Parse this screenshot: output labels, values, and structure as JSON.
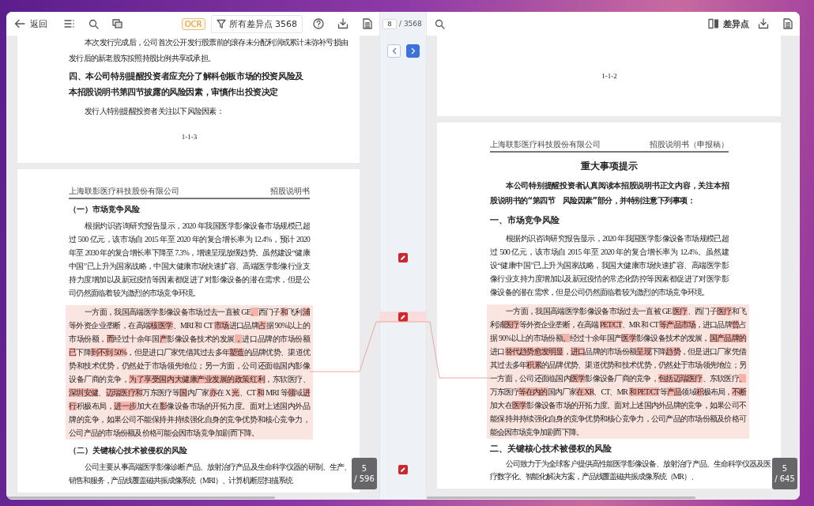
{
  "toolbar": {
    "back": "返回",
    "ocr": "OCR",
    "filter": "所有差异点 3568"
  },
  "navigator": {
    "current": "8",
    "total": "/ 3568"
  },
  "right_toolbar": {
    "diff_toggle": "差异点"
  },
  "documents": [
    {
      "pages": [
        {
          "blocks": [
            {
              "kind": "para",
              "text": "本次发行完成后，公司首次公开发行股票前的滚存未分配利润或累计未弥补亏损由"
            },
            {
              "kind": "plain",
              "text": "发行后的新老股东按照持股比例共享或承担。"
            },
            {
              "kind": "big_heading",
              "text": "四、本公司特别提醒投资者应充分了解科创板市场的投资风险及本招股说明书第四节披露的风险因素，审慎作出投资决定"
            },
            {
              "kind": "para",
              "text": "发行人特别提醒投资者关注以下风险因素："
            },
            {
              "kind": "footer",
              "text": "1-1-3"
            }
          ]
        },
        {
          "blocks": [
            {
              "kind": "header",
              "left": "上海联影医疗科技股份有限公司",
              "right": "招股说明书"
            },
            {
              "kind": "heading",
              "text": "（一）市场竞争风险"
            },
            {
              "kind": "para",
              "text": "根据灼识咨询研究报告显示，2020 年我国医学影像设备市场规模已超过 500 亿元，该市场自 2015 年至 2020 年的复合增长率为 12.4%，预计 2020 年至 2030 年的复合增长率下降至 7.3%，增速呈现放缓趋势。虽然建设“健康中国”已上升为国家战略，中国大健康市场快速扩容、高端医学影像行业支持力度增加以及新冠疫情等因素都促进了对影像设备的潜在需求，但是公司仍然面临着较为激烈的市场竞争环境。"
            },
            {
              "kind": "diff",
              "segments": [
                {
                  "text": "一方面，我国高端医学影像设备市场过去一直被 GE",
                  "changed": false
                },
                {
                  "text": "、",
                  "changed": true
                },
                {
                  "text": "西门子",
                  "changed": false
                },
                {
                  "text": "和",
                  "changed": true
                },
                {
                  "text": "飞利",
                  "changed": false
                },
                {
                  "text": "浦",
                  "changed": true
                },
                {
                  "text": "等外资企业垄断，在高端",
                  "changed": false
                },
                {
                  "text": "核医学",
                  "changed": true
                },
                {
                  "text": "、MRI 和 CT ",
                  "changed": false
                },
                {
                  "text": "市场",
                  "changed": true
                },
                {
                  "text": "进口品牌",
                  "changed": false
                },
                {
                  "text": "占",
                  "changed": true
                },
                {
                  "text": "据 90%以上的市场份额，",
                  "changed": false
                },
                {
                  "text": "而",
                  "changed": true
                },
                {
                  "text": "经过十余年国",
                  "changed": false
                },
                {
                  "text": "产",
                  "changed": true
                },
                {
                  "text": "影像设备技术的发展",
                  "changed": false
                },
                {
                  "text": "，",
                  "changed": true
                },
                {
                  "text": "进口品牌的市场份额",
                  "changed": false
                },
                {
                  "text": "已",
                  "changed": true
                },
                {
                  "text": "下降",
                  "changed": false
                },
                {
                  "text": "到不到 50%",
                  "changed": true
                },
                {
                  "text": "，但是进口厂家凭借其过去多年",
                  "changed": false
                },
                {
                  "text": "塑造",
                  "changed": true
                },
                {
                  "text": "的品牌优势、渠道优势和技术优势，仍然处于市场领先地位；另一方面，公司还面临国内影像设备厂商的竞争，",
                  "changed": false
                },
                {
                  "text": "为了享受国内大健康产业发展的政策红利",
                  "changed": true
                },
                {
                  "text": "，东软医疗、",
                  "changed": false
                },
                {
                  "text": "深圳安健",
                  "changed": true
                },
                {
                  "text": "、",
                  "changed": false
                },
                {
                  "text": "迈瑞医疗和",
                  "changed": true
                },
                {
                  "text": "万东医疗等",
                  "changed": false
                },
                {
                  "text": "国",
                  "changed": true
                },
                {
                  "text": "内厂家",
                  "changed": false
                },
                {
                  "text": "亦",
                  "changed": true
                },
                {
                  "text": "在 X ",
                  "changed": false
                },
                {
                  "text": "光",
                  "changed": true
                },
                {
                  "text": "、CT ",
                  "changed": false
                },
                {
                  "text": "和",
                  "changed": true
                },
                {
                  "text": " MRI 等",
                  "changed": false
                },
                {
                  "text": "领",
                  "changed": true
                },
                {
                  "text": "域",
                  "changed": false
                },
                {
                  "text": "进行",
                  "changed": true
                },
                {
                  "text": "积极布局，",
                  "changed": false
                },
                {
                  "text": "进一步",
                  "changed": true
                },
                {
                  "text": "加大在",
                  "changed": false
                },
                {
                  "text": "影",
                  "changed": true
                },
                {
                  "text": "像设备市场的开拓力度。面对上述国内外品牌的竞争，如果公司不能保持并持续强化自身的竞争优势和核心竞争力，公司产品的市场份额及价格可能会因市场竞争加剧而下降。",
                  "changed": false
                }
              ]
            },
            {
              "kind": "heading",
              "text": "（二）关键核心技术被侵权的风险"
            },
            {
              "kind": "para",
              "text": "公司主要从事高端医学影像诊断产品、放射治疗产品及生命科学仪器的研制、生产、销售和服务，产品线覆盖磁共振成像系统（MRI）、计算机断层扫描系统"
            }
          ]
        }
      ],
      "page_indicator": {
        "current": "5",
        "total": "/ 596"
      }
    },
    {
      "pages": [
        {
          "blocks": [
            {
              "kind": "footer",
              "text": "1-1-2"
            }
          ]
        },
        {
          "blocks": [
            {
              "kind": "header",
              "left": "上海联影医疗科技股份有限公司",
              "right": "招股说明书（申报稿）"
            },
            {
              "kind": "title",
              "text": "重大事项提示"
            },
            {
              "kind": "bold_para",
              "text": "本公司特别提醒投资者认真阅读本招股说明书正文内容，关注本招股说明书的“第四节　风险因素”部分，并特别注意下列事项："
            },
            {
              "kind": "section",
              "text": "一、市场竞争风险"
            },
            {
              "kind": "para",
              "text": "根据灼识咨询研究报告显示，2020 年我国医学影像设备市场规模已超过 500 亿元，该市场自 2015 年至 2020 年的复合增长率为 12.4%。虽然建设“健康中国”已上升为国家战略，我国大健康市场快速扩容、高端医学影像行业支持力度增加以及新冠疫情的常态化防控等因素都促进了对医学影像设备的潜在需求，但是公司仍然面临着较为激烈的市场竞争环境。"
            },
            {
              "kind": "diff",
              "segments": [
                {
                  "text": "一方面，我国高端医学影像设备市场过去一直被 GE ",
                  "changed": false
                },
                {
                  "text": "医疗",
                  "changed": true
                },
                {
                  "text": "、西门子",
                  "changed": false
                },
                {
                  "text": "医疗",
                  "changed": true
                },
                {
                  "text": "和飞利浦",
                  "changed": false
                },
                {
                  "text": "医疗",
                  "changed": true
                },
                {
                  "text": "等外资企业垄断，在高端 ",
                  "changed": false
                },
                {
                  "text": "PET/CT",
                  "changed": true
                },
                {
                  "text": "、MR 和 CT ",
                  "changed": false
                },
                {
                  "text": "等产品市场",
                  "changed": true
                },
                {
                  "text": "，进口品牌",
                  "changed": false
                },
                {
                  "text": "曾",
                  "changed": true
                },
                {
                  "text": "占据 90%以上的市场份额",
                  "changed": false
                },
                {
                  "text": "。",
                  "changed": true
                },
                {
                  "text": "经过十余年国产",
                  "changed": false
                },
                {
                  "text": "医学",
                  "changed": true
                },
                {
                  "text": "影像设备技术的发展，",
                  "changed": false
                },
                {
                  "text": "国产品牌的",
                  "changed": true
                },
                {
                  "text": "进口",
                  "changed": false
                },
                {
                  "text": "替代趋势愈发明显",
                  "changed": true
                },
                {
                  "text": "，",
                  "changed": false
                },
                {
                  "text": "进口",
                  "changed": true
                },
                {
                  "text": "品牌的市场份额",
                  "changed": false
                },
                {
                  "text": "呈现",
                  "changed": true
                },
                {
                  "text": "下降",
                  "changed": false
                },
                {
                  "text": "趋势",
                  "changed": true
                },
                {
                  "text": "，但是进口厂家凭借其过去多年",
                  "changed": false
                },
                {
                  "text": "积累",
                  "changed": true
                },
                {
                  "text": "的品牌优势、渠道优势和技术优势，仍然处于市场领先地位；另一方面，公司还面临国内",
                  "changed": false
                },
                {
                  "text": "医学",
                  "changed": true
                },
                {
                  "text": "影像设备厂商的竞争，",
                  "changed": false
                },
                {
                  "text": "包括迈瑞医疗",
                  "changed": true
                },
                {
                  "text": "、东软医疗",
                  "changed": false
                },
                {
                  "text": "、",
                  "changed": true
                },
                {
                  "text": "万东医疗",
                  "changed": false
                },
                {
                  "text": "等在内的",
                  "changed": true
                },
                {
                  "text": "国内厂家",
                  "changed": false
                },
                {
                  "text": "在 XR",
                  "changed": true
                },
                {
                  "text": "、CT、MR ",
                  "changed": false
                },
                {
                  "text": "和 PET/CT",
                  "changed": true
                },
                {
                  "text": " 等",
                  "changed": false
                },
                {
                  "text": "产品",
                  "changed": true
                },
                {
                  "text": "领域",
                  "changed": false
                },
                {
                  "text": "积",
                  "changed": true
                },
                {
                  "text": "极布局，",
                  "changed": false
                },
                {
                  "text": "不断",
                  "changed": true
                },
                {
                  "text": "加大在",
                  "changed": false
                },
                {
                  "text": "医学",
                  "changed": true
                },
                {
                  "text": "影像设备市场的开拓力度。面对上述国内外品牌的竞争，如果公司不能保持并持续强化自身的竞争优势和核心竞争力，公司产品的市场份额及价格可能会因市场竞争加剧而下降。",
                  "changed": false
                }
              ]
            },
            {
              "kind": "section",
              "text": "二、关键核心技术被侵权的风险"
            },
            {
              "kind": "para",
              "text": "公司致力于为全球客户提供高性能医学影像设备、放射治疗产品、生命科学仪器及医疗数字化、智能化解决方案，产品线覆盖磁共振成像系统（MR）、"
            }
          ]
        }
      ],
      "page_indicator": {
        "current": "5",
        "total": "/ 645"
      }
    }
  ],
  "diff_markers": [
    {
      "selected": false
    },
    {
      "selected": true
    },
    {
      "selected": false
    }
  ]
}
